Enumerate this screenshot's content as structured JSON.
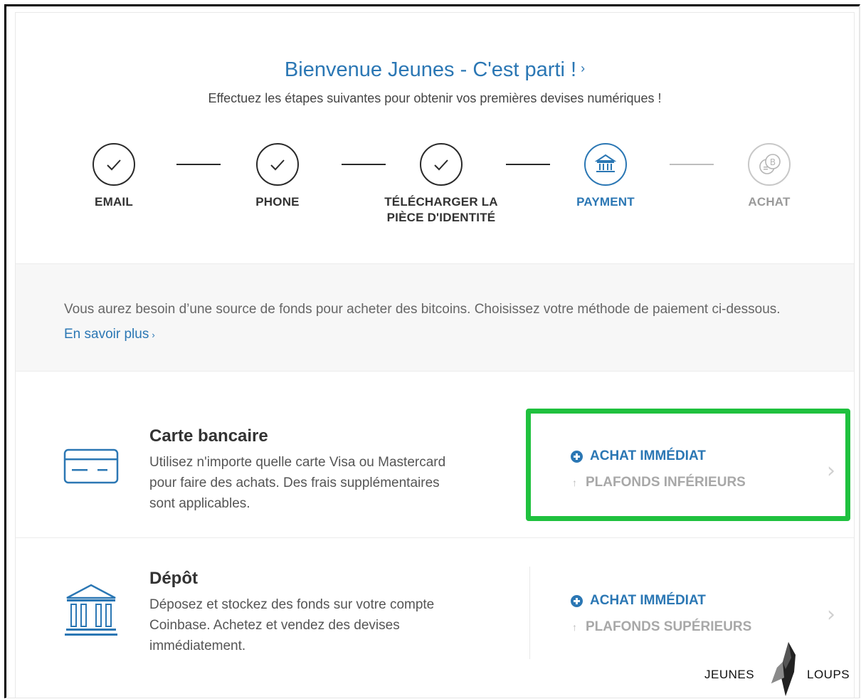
{
  "header": {
    "title": "Bienvenue Jeunes - C'est parti !",
    "title_chevron": "›",
    "subtitle": "Effectuez les étapes suivantes pour obtenir vos premières devises numériques !"
  },
  "steps": [
    {
      "label": "EMAIL",
      "state": "done",
      "icon": "check-icon"
    },
    {
      "label": "PHONE",
      "state": "done",
      "icon": "check-icon"
    },
    {
      "label": "TÉLÉCHARGER LA PIÈCE D'IDENTITÉ",
      "state": "done",
      "icon": "check-icon"
    },
    {
      "label": "PAYMENT",
      "state": "active",
      "icon": "bank-icon"
    },
    {
      "label": "ACHAT",
      "state": "pending",
      "icon": "coins-icon"
    }
  ],
  "info": {
    "text": "Vous aurez besoin d’une source de fonds pour acheter des bitcoins. Choisissez votre méthode de paiement ci-dessous.",
    "link": "En savoir plus",
    "link_chevron": "›"
  },
  "methods": [
    {
      "title": "Carte bancaire",
      "description": "Utilisez n'importe quelle carte Visa ou Mastercard pour faire des achats. Des frais supplémentaires sont applicables.",
      "icon": "credit-card-icon",
      "option_primary": "ACHAT IMMÉDIAT",
      "option_secondary": "PLAFONDS INFÉRIEURS",
      "chevron": "›"
    },
    {
      "title": "Dépôt",
      "description": "Déposez et stockez des fonds sur votre compte Coinbase. Achetez et vendez des devises immédiatement.",
      "icon": "bank-icon",
      "option_primary": "ACHAT IMMÉDIAT",
      "option_secondary": "PLAFONDS SUPÉRIEURS",
      "chevron": "›"
    }
  ],
  "highlight_color": "#1fc13e",
  "accent_color": "#2b77b4",
  "watermark": {
    "left": "JEUNES",
    "right": "LOUPS"
  }
}
